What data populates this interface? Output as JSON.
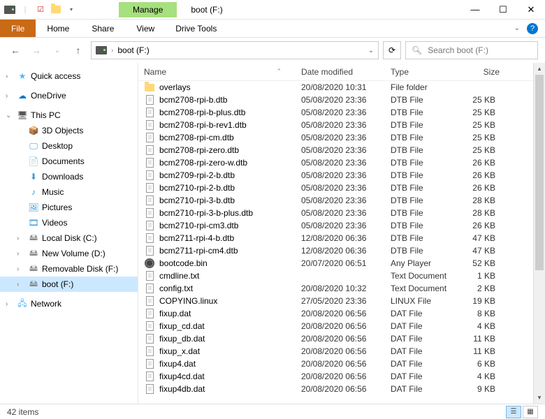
{
  "title": "boot (F:)",
  "manage_label": "Manage",
  "drive_tools_label": "Drive Tools",
  "tabs": {
    "file": "File",
    "home": "Home",
    "share": "Share",
    "view": "View"
  },
  "address": {
    "label": "boot (F:)"
  },
  "search": {
    "placeholder": "Search boot (F:)"
  },
  "columns": {
    "name": "Name",
    "date": "Date modified",
    "type": "Type",
    "size": "Size"
  },
  "sidebar": {
    "quick": "Quick access",
    "onedrive": "OneDrive",
    "thispc": "This PC",
    "items": [
      {
        "label": "3D Objects"
      },
      {
        "label": "Desktop"
      },
      {
        "label": "Documents"
      },
      {
        "label": "Downloads"
      },
      {
        "label": "Music"
      },
      {
        "label": "Pictures"
      },
      {
        "label": "Videos"
      },
      {
        "label": "Local Disk (C:)"
      },
      {
        "label": "New Volume (D:)"
      },
      {
        "label": "Removable Disk (F:)"
      },
      {
        "label": "boot (F:)"
      }
    ],
    "network": "Network"
  },
  "files": [
    {
      "name": "overlays",
      "date": "20/08/2020 10:31",
      "type": "File folder",
      "size": "",
      "icon": "folder"
    },
    {
      "name": "bcm2708-rpi-b.dtb",
      "date": "05/08/2020 23:36",
      "type": "DTB File",
      "size": "25 KB",
      "icon": "doc"
    },
    {
      "name": "bcm2708-rpi-b-plus.dtb",
      "date": "05/08/2020 23:36",
      "type": "DTB File",
      "size": "25 KB",
      "icon": "doc"
    },
    {
      "name": "bcm2708-rpi-b-rev1.dtb",
      "date": "05/08/2020 23:36",
      "type": "DTB File",
      "size": "25 KB",
      "icon": "doc"
    },
    {
      "name": "bcm2708-rpi-cm.dtb",
      "date": "05/08/2020 23:36",
      "type": "DTB File",
      "size": "25 KB",
      "icon": "doc"
    },
    {
      "name": "bcm2708-rpi-zero.dtb",
      "date": "05/08/2020 23:36",
      "type": "DTB File",
      "size": "25 KB",
      "icon": "doc"
    },
    {
      "name": "bcm2708-rpi-zero-w.dtb",
      "date": "05/08/2020 23:36",
      "type": "DTB File",
      "size": "26 KB",
      "icon": "doc"
    },
    {
      "name": "bcm2709-rpi-2-b.dtb",
      "date": "05/08/2020 23:36",
      "type": "DTB File",
      "size": "26 KB",
      "icon": "doc"
    },
    {
      "name": "bcm2710-rpi-2-b.dtb",
      "date": "05/08/2020 23:36",
      "type": "DTB File",
      "size": "26 KB",
      "icon": "doc"
    },
    {
      "name": "bcm2710-rpi-3-b.dtb",
      "date": "05/08/2020 23:36",
      "type": "DTB File",
      "size": "28 KB",
      "icon": "doc"
    },
    {
      "name": "bcm2710-rpi-3-b-plus.dtb",
      "date": "05/08/2020 23:36",
      "type": "DTB File",
      "size": "28 KB",
      "icon": "doc"
    },
    {
      "name": "bcm2710-rpi-cm3.dtb",
      "date": "05/08/2020 23:36",
      "type": "DTB File",
      "size": "26 KB",
      "icon": "doc"
    },
    {
      "name": "bcm2711-rpi-4-b.dtb",
      "date": "12/08/2020 06:36",
      "type": "DTB File",
      "size": "47 KB",
      "icon": "doc"
    },
    {
      "name": "bcm2711-rpi-cm4.dtb",
      "date": "12/08/2020 06:36",
      "type": "DTB File",
      "size": "47 KB",
      "icon": "doc"
    },
    {
      "name": "bootcode.bin",
      "date": "20/07/2020 06:51",
      "type": "Any Player",
      "size": "52 KB",
      "icon": "bin"
    },
    {
      "name": "cmdline.txt",
      "date": "",
      "type": "Text Document",
      "size": "1 KB",
      "icon": "doc"
    },
    {
      "name": "config.txt",
      "date": "20/08/2020 10:32",
      "type": "Text Document",
      "size": "2 KB",
      "icon": "doc"
    },
    {
      "name": "COPYING.linux",
      "date": "27/05/2020 23:36",
      "type": "LINUX File",
      "size": "19 KB",
      "icon": "doc"
    },
    {
      "name": "fixup.dat",
      "date": "20/08/2020 06:56",
      "type": "DAT File",
      "size": "8 KB",
      "icon": "doc"
    },
    {
      "name": "fixup_cd.dat",
      "date": "20/08/2020 06:56",
      "type": "DAT File",
      "size": "4 KB",
      "icon": "doc"
    },
    {
      "name": "fixup_db.dat",
      "date": "20/08/2020 06:56",
      "type": "DAT File",
      "size": "11 KB",
      "icon": "doc"
    },
    {
      "name": "fixup_x.dat",
      "date": "20/08/2020 06:56",
      "type": "DAT File",
      "size": "11 KB",
      "icon": "doc"
    },
    {
      "name": "fixup4.dat",
      "date": "20/08/2020 06:56",
      "type": "DAT File",
      "size": "6 KB",
      "icon": "doc"
    },
    {
      "name": "fixup4cd.dat",
      "date": "20/08/2020 06:56",
      "type": "DAT File",
      "size": "4 KB",
      "icon": "doc"
    },
    {
      "name": "fixup4db.dat",
      "date": "20/08/2020 06:56",
      "type": "DAT File",
      "size": "9 KB",
      "icon": "doc"
    }
  ],
  "status": {
    "count": "42 items"
  }
}
